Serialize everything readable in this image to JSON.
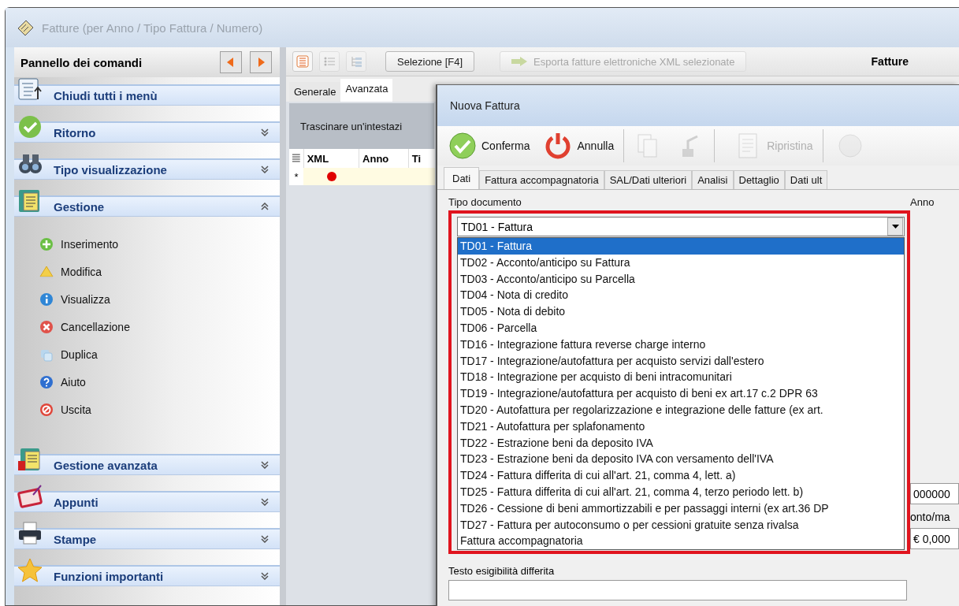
{
  "window": {
    "title": "Fatture (per Anno / Tipo Fattura / Numero)"
  },
  "command_panel": {
    "title": "Pannello dei comandi",
    "sections": [
      {
        "kind": "action",
        "label": "Chiudi tutti i menù"
      },
      {
        "kind": "group",
        "label": "Ritorno",
        "expanded": false
      },
      {
        "kind": "group",
        "label": "Tipo visualizzazione",
        "expanded": false
      },
      {
        "kind": "group",
        "label": "Gestione",
        "expanded": true,
        "items": [
          "Inserimento",
          "Modifica",
          "Visualizza",
          "Cancellazione",
          "Duplica",
          "Aiuto",
          "Uscita"
        ]
      },
      {
        "kind": "group",
        "label": "Gestione avanzata",
        "expanded": false
      },
      {
        "kind": "group",
        "label": "Appunti",
        "expanded": false
      },
      {
        "kind": "group",
        "label": "Stampe",
        "expanded": false
      },
      {
        "kind": "group",
        "label": "Funzioni importanti",
        "expanded": false
      }
    ]
  },
  "main": {
    "toolbar": {
      "buttons": [
        {
          "kind": "icon",
          "disabled": false
        },
        {
          "kind": "icon",
          "disabled": true
        },
        {
          "kind": "icon",
          "disabled": true
        },
        {
          "kind": "text",
          "label": "Selezione [F4]",
          "disabled": false
        },
        {
          "kind": "icon_text",
          "label": "Esporta fatture elettroniche XML selezionate",
          "disabled": true
        }
      ],
      "title": "Fatture"
    },
    "tabs": [
      {
        "label": "Generale",
        "selected": false
      },
      {
        "label": "Avanzata",
        "selected": true
      }
    ],
    "group_hint": "Trascinare un'intestazi",
    "grid": {
      "columns": [
        "XML",
        "Anno",
        "Ti"
      ],
      "new_row": {
        "marker": "*"
      }
    }
  },
  "dialog": {
    "title": "Nuova Fattura",
    "toolbar": [
      {
        "kind": "confirm",
        "label": "Conferma",
        "disabled": false
      },
      {
        "kind": "cancel",
        "label": "Annulla",
        "disabled": false
      },
      {
        "kind": "copy",
        "disabled": true
      },
      {
        "kind": "tool",
        "disabled": true
      },
      {
        "kind": "restore",
        "label": "Ripristina",
        "disabled": true
      },
      {
        "kind": "clipped",
        "disabled": true
      }
    ],
    "tabs": [
      {
        "label": "Dati",
        "selected": true
      },
      {
        "label": "Fattura accompagnatoria",
        "selected": false
      },
      {
        "label": "SAL/Dati ulteriori",
        "selected": false
      },
      {
        "label": "Analisi",
        "selected": false
      },
      {
        "label": "Dettaglio",
        "selected": false
      },
      {
        "label": "Dati ult",
        "selected": false
      }
    ],
    "document_type": {
      "label": "Tipo documento",
      "value": "TD01 - Fattura",
      "options": [
        {
          "label": "TD01 - Fattura",
          "selected": true
        },
        {
          "label": "TD02 - Acconto/anticipo su Fattura",
          "selected": false
        },
        {
          "label": "TD03 - Acconto/anticipo su Parcella",
          "selected": false
        },
        {
          "label": "TD04 - Nota di credito",
          "selected": false
        },
        {
          "label": "TD05 - Nota di debito",
          "selected": false
        },
        {
          "label": "TD06 - Parcella",
          "selected": false
        },
        {
          "label": "TD16 - Integrazione fattura reverse charge interno",
          "selected": false
        },
        {
          "label": "TD17 - Integrazione/autofattura per acquisto servizi dall'estero",
          "selected": false
        },
        {
          "label": "TD18 - Integrazione per acquisto di beni intracomunitari",
          "selected": false
        },
        {
          "label": "TD19 - Integrazione/autofattura per acquisto di beni ex art.17 c.2 DPR 63",
          "selected": false
        },
        {
          "label": "TD20 - Autofattura per regolarizzazione e integrazione delle fatture (ex art.",
          "selected": false
        },
        {
          "label": "TD21 - Autofattura per splafonamento",
          "selected": false
        },
        {
          "label": "TD22 - Estrazione beni da deposito IVA",
          "selected": false
        },
        {
          "label": "TD23 - Estrazione beni da deposito IVA con versamento dell'IVA",
          "selected": false
        },
        {
          "label": "TD24 - Fattura differita di cui all'art. 21, comma 4, lett. a)",
          "selected": false
        },
        {
          "label": "TD25 - Fattura differita di cui all'art. 21, comma 4, terzo periodo lett. b)",
          "selected": false
        },
        {
          "label": "TD26 - Cessione di beni ammortizzabili e per passaggi interni (ex art.36 DP",
          "selected": false
        },
        {
          "label": "TD27 - Fattura per autoconsumo o per cessioni gratuite senza rivalsa",
          "selected": false
        },
        {
          "label": "Fattura accompagnatoria",
          "selected": false
        }
      ]
    },
    "year_label": "Anno",
    "side_fields": [
      {
        "kind": "field",
        "text": "000000"
      },
      {
        "kind": "label",
        "text": "onto/ma"
      },
      {
        "kind": "field",
        "text": "€ 0,000"
      }
    ],
    "deferred_text": {
      "label": "Testo esigibilità differita"
    }
  }
}
